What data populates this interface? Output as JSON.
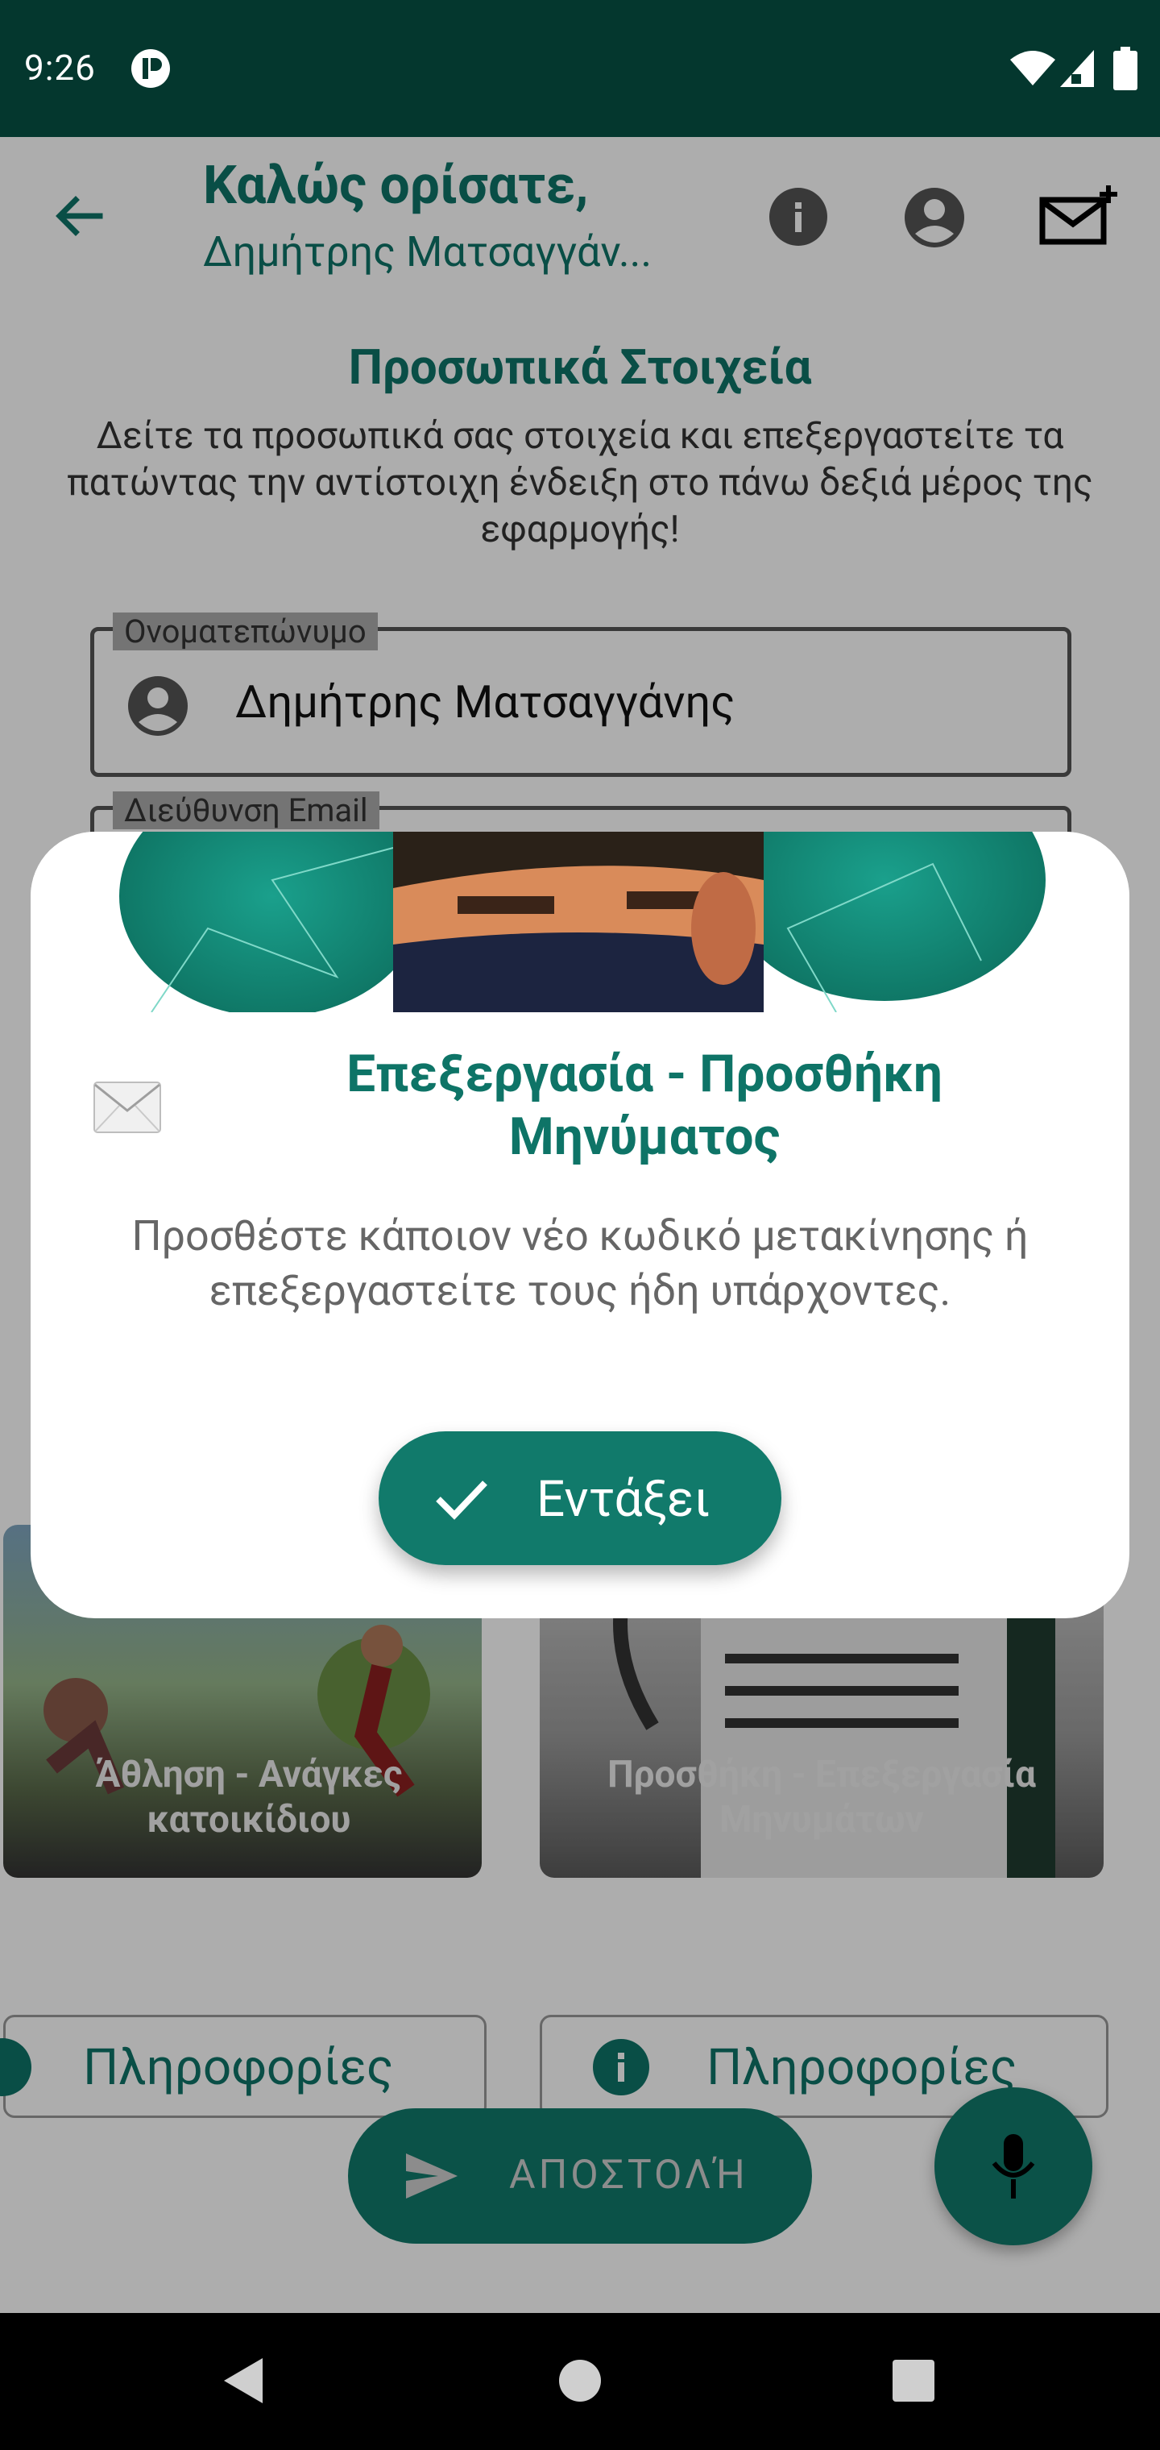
{
  "status_bar": {
    "time": "9:26"
  },
  "header": {
    "title": "Καλώς ορίσατε,",
    "subtitle": "Δημήτρης Ματσαγγάν..."
  },
  "section": {
    "heading": "Προσωπικά Στοιχεία",
    "description": "Δείτε τα προσωπικά σας στοιχεία και επεξεργαστείτε τα πατώντας την αντίστοιχη ένδειξη στο πάνω δεξιά μέρος της εφαρμογής!"
  },
  "fields": {
    "name_label": "Ονοματεπώνυμο",
    "name_value": "Δημήτρης Ματσαγγάνης",
    "email_label": "Διεύθυνση Email"
  },
  "cards": [
    {
      "title": "Άθληση - Ανάγκες κατοικίδιου",
      "info_label": "Πληροφορίες"
    },
    {
      "title": "Προσθήκη - Επεξεργασία Μηνυμάτων",
      "info_label": "Πληροφορίες"
    }
  ],
  "actions": {
    "send_label": "ΑΠΟΣΤΟΛΉ"
  },
  "dialog": {
    "title": "Επεξεργασία - Προσθήκη Μηνύματος",
    "message": "Προσθέστε κάποιον νέο κωδικό μετακίνησης ή επεξεργαστείτε τους ήδη υπάρχοντες.",
    "ok_label": "Εντάξει"
  },
  "colors": {
    "accent": "#117a6b",
    "status_bar": "#04372e"
  }
}
